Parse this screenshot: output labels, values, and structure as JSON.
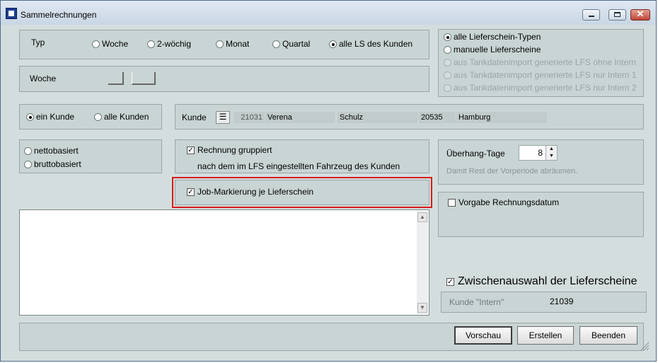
{
  "window": {
    "title": "Sammelrechnungen"
  },
  "typ": {
    "label": "Typ",
    "options": [
      "Woche",
      "2-wöchig",
      "Monat",
      "Quartal",
      "alle LS des Kunden"
    ],
    "selected": "alle LS des Kunden"
  },
  "woche": {
    "label": "Woche"
  },
  "lieferschein_typen": {
    "options": [
      "alle Lieferschein-Typen",
      "manuelle Lieferscheine",
      "aus Tankdatenimport generierte LFS ohne Intern",
      "aus Tankdatenimport generierte LFS nur Intern 1",
      "aus Tankdatenimport generierte LFS nur Intern 2"
    ],
    "selected": "alle Lieferschein-Typen"
  },
  "kunden_auswahl": {
    "options": [
      "ein Kunde",
      "alle Kunden"
    ],
    "selected": "ein Kunde"
  },
  "kunde": {
    "label": "Kunde",
    "icon": "list-icon",
    "nummer": "21031",
    "vorname": "Verena",
    "nachname": "Schulz",
    "plz": "20535",
    "ort": "Hamburg"
  },
  "basis": {
    "options": [
      "nettobasiert",
      "bruttobasiert"
    ],
    "selected": null
  },
  "gruppierung": {
    "checkbox_label": "Rechnung gruppiert",
    "checked": true,
    "description": "nach dem im LFS eingestellten Fahrzeug des Kunden"
  },
  "job_markierung": {
    "label": "Job-Markierung je Lieferschein",
    "checked": true
  },
  "ueberhang": {
    "label": "Überhang-Tage",
    "value": "8",
    "hint": "Damit Rest der Vorperiode abräumen."
  },
  "rechnungsdatum": {
    "label": "Vorgabe Rechnungsdatum",
    "checked": false
  },
  "zwischenauswahl": {
    "label": "Zwischenauswahl der Lieferscheine",
    "checked": true
  },
  "kunde_intern": {
    "label": "Kunde \"Intern\"",
    "value": "21039"
  },
  "buttons": {
    "vorschau": "Vorschau",
    "erstellen": "Erstellen",
    "beenden": "Beenden"
  },
  "colors": {
    "highlight": "#d81b1b",
    "panel": "#c9d4d4",
    "background": "#d4dddd"
  }
}
